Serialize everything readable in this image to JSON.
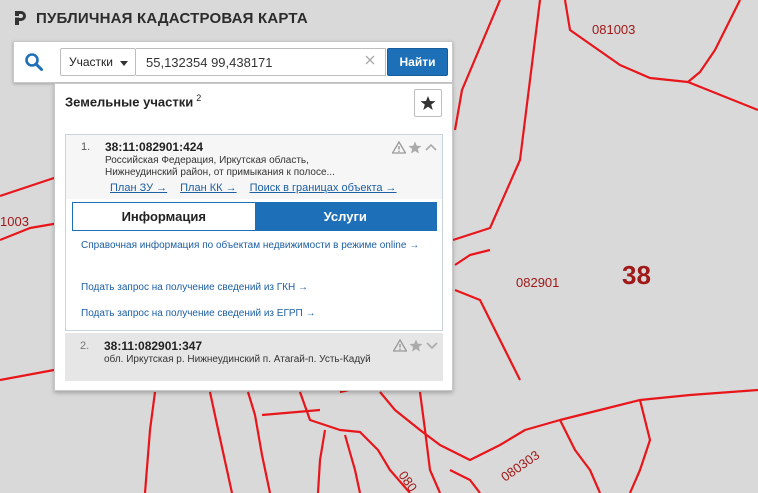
{
  "app": {
    "title": "ПУБЛИЧНАЯ КАДАСТРОВАЯ КАРТА"
  },
  "search": {
    "type_label": "Участки",
    "query": "55,132354 99,438171",
    "find_label": "Найти"
  },
  "results": {
    "title": "Земельные участки",
    "count": "2",
    "items": [
      {
        "num": "1.",
        "cad_number": "38:11:082901:424",
        "address_line1": "Российская Федерация, Иркутская область,",
        "address_line2": "Нижнеудинский район, от примыкания к полосе...",
        "links": [
          "План ЗУ →",
          "План КК →",
          "Поиск в границах объекта →"
        ],
        "tabs": [
          "Информация",
          "Услуги"
        ],
        "services": [
          "Справочная информация по объектам недвижимости в режиме online →",
          "Подать запрос на получение сведений из ГКН →",
          "Подать запрос на получение сведений из ЕГРП →"
        ]
      },
      {
        "num": "2.",
        "cad_number": "38:11:082901:347",
        "address": "обл. Иркутская р. Нижнеудинский п. Атагай-п. Усть-Кадуй"
      }
    ]
  },
  "map": {
    "labels": [
      "081003",
      "1003",
      "082901",
      "38",
      "080303",
      "080"
    ],
    "line_color": "#e8161b",
    "label_color": "#a01818"
  },
  "colors": {
    "accent": "#1d6fb8",
    "link": "#1d5fa3"
  }
}
